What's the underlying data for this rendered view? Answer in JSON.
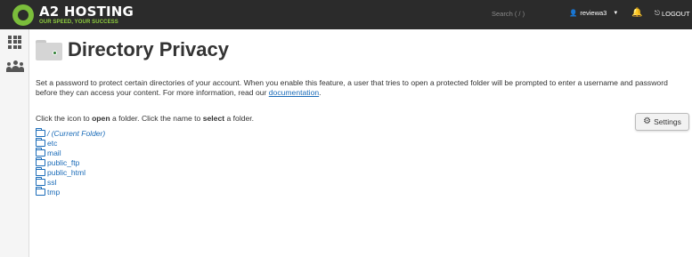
{
  "brand": {
    "name": "A2 HOSTING",
    "tagline": "OUR SPEED, YOUR SUCCESS"
  },
  "topbar": {
    "search_placeholder": "Search ( / )",
    "username": "reviewa3",
    "logout_label": "LOGOUT"
  },
  "sidebar": {
    "items": [
      {
        "icon": "grid-icon"
      },
      {
        "icon": "users-icon"
      }
    ]
  },
  "page": {
    "title": "Directory Privacy",
    "description": "Set a password to protect certain directories of your account. When you enable this feature, a user that tries to open a protected folder will be prompted to enter a username and password before they can access your content. For more information, read our ",
    "doc_link": "documentation",
    "description_end": ".",
    "instruction_pre": "Click the icon to ",
    "instruction_open": "open",
    "instruction_mid": " a folder. Click the name to ",
    "instruction_select": "select",
    "instruction_post": " a folder.",
    "settings_label": "Settings"
  },
  "folders": [
    {
      "name": "/ (Current Folder)"
    },
    {
      "name": "etc"
    },
    {
      "name": "mail"
    },
    {
      "name": "public_ftp"
    },
    {
      "name": "public_html"
    },
    {
      "name": "ssl"
    },
    {
      "name": "tmp"
    }
  ],
  "colors": {
    "topbar": "#2b2b2b",
    "brand_green": "#7bbd3b",
    "link": "#1a6bb8"
  }
}
